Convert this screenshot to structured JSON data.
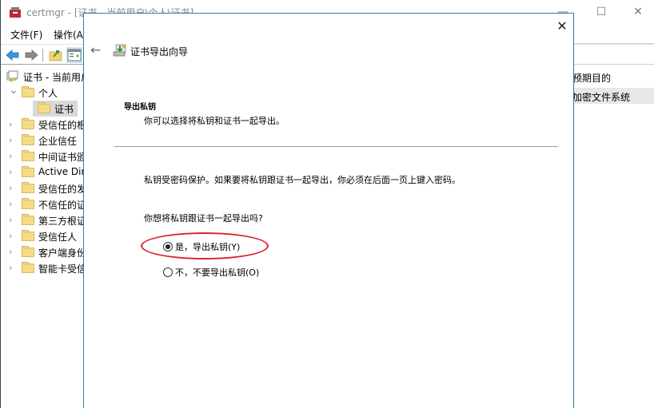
{
  "window": {
    "title": "certmgr - [证书 - 当前用户\\个人\\证书]",
    "controls": {
      "minimize": "—",
      "maximize": "☐",
      "close": "✕"
    }
  },
  "menu": [
    "文件(F)",
    "操作(A)"
  ],
  "toolbar": {
    "buttons": [
      "back-icon",
      "forward-icon",
      "up-folder-icon",
      "show-hide-console-tree-icon"
    ]
  },
  "tree": {
    "root": "证书 - 当前用户",
    "items": [
      {
        "label": "个人",
        "expanded": true,
        "level": 1
      },
      {
        "label": "证书",
        "level": 2,
        "selected": true
      },
      {
        "label": "受信任的根",
        "level": 1
      },
      {
        "label": "企业信任",
        "level": 1
      },
      {
        "label": "中间证书颁",
        "level": 1
      },
      {
        "label": "Active Dire",
        "level": 1
      },
      {
        "label": "受信任的发",
        "level": 1
      },
      {
        "label": "不信任的证",
        "level": 1
      },
      {
        "label": "第三方根证",
        "level": 1
      },
      {
        "label": "受信任人",
        "level": 1
      },
      {
        "label": "客户端身份",
        "level": 1
      },
      {
        "label": "智能卡受信",
        "level": 1
      }
    ]
  },
  "right_pane": {
    "column_header": "预期目的",
    "rows": [
      "加密文件系统"
    ]
  },
  "wizard": {
    "title": "证书导出向导",
    "section_heading": "导出私钥",
    "section_subtitle": "你可以选择将私钥和证书一起导出。",
    "info_text": "私钥受密码保护。如果要将私钥跟证书一起导出，你必须在后面一页上键入密码。",
    "question": "你想将私钥跟证书一起导出吗?",
    "options": [
      {
        "label": "是，导出私钥(Y)",
        "checked": true
      },
      {
        "label": "不，不要导出私钥(O)",
        "checked": false
      }
    ],
    "close": "✕",
    "back": "←"
  },
  "colors": {
    "dialog_border": "#2b7fa8",
    "highlight_ellipse": "#d9262b",
    "folder": "#f5dc8a",
    "selected_bg": "#d9d9d9"
  }
}
